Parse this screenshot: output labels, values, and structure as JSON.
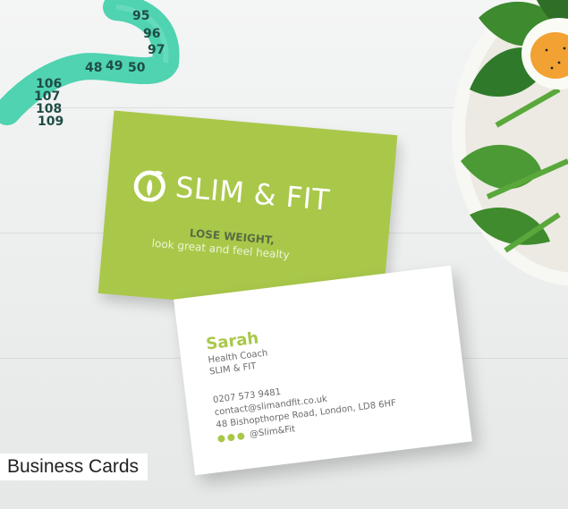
{
  "caption": "Business Cards",
  "tape_numbers": [
    "95",
    "96",
    "97",
    "50",
    "49",
    "48",
    "106",
    "107",
    "108",
    "109"
  ],
  "green_card": {
    "brand": "SLIM & FIT",
    "tagline_bold": "LOSE WEIGHT,",
    "tagline": "look great and feel healty"
  },
  "white_card": {
    "name": "Sarah",
    "role": "Health Coach",
    "company": "SLIM & FIT",
    "phone": "0207 573 9481",
    "email": "contact@slimandfit.co.uk",
    "address": "48 Bishopthorpe Road, London, LD8 6HF",
    "social_handle": "@Slim&Fit",
    "social_icons": [
      "facebook-icon",
      "twitter-icon",
      "instagram-icon"
    ]
  },
  "colors": {
    "brand_green": "#a9c84a",
    "tape_green": "#4fd3b0",
    "background": "#eef0f0"
  }
}
